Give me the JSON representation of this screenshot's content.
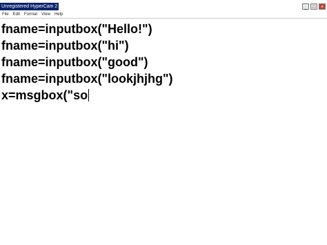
{
  "watermark": "Unregistered HyperCam 2",
  "menu": [
    "File",
    "Edit",
    "Format",
    "View",
    "Help"
  ],
  "window_controls": {
    "minimize": "_",
    "maximize": "□",
    "close": "×"
  },
  "editor": {
    "lines": [
      "fname=inputbox(\"Hello!\")",
      "fname=inputbox(\"hi\")",
      "fname=inputbox(\"good\")",
      "fname=inputbox(\"lookjhjhg\")",
      "x=msgbox(\"so"
    ]
  }
}
